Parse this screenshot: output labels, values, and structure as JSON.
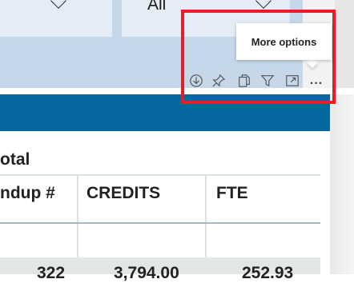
{
  "slicer": {
    "second_value": "All"
  },
  "toolbar": {
    "icons": [
      "download-icon",
      "pin-icon",
      "copy-icon",
      "filter-icon",
      "focus-mode-icon",
      "more-options-icon"
    ],
    "more_glyph": "..."
  },
  "tooltip": {
    "text": "More options"
  },
  "table": {
    "total_label": "otal",
    "columns": [
      "ndup #",
      "CREDITS",
      "FTE"
    ],
    "row_values": [
      "322",
      "3,794.00",
      "252.93"
    ]
  }
}
